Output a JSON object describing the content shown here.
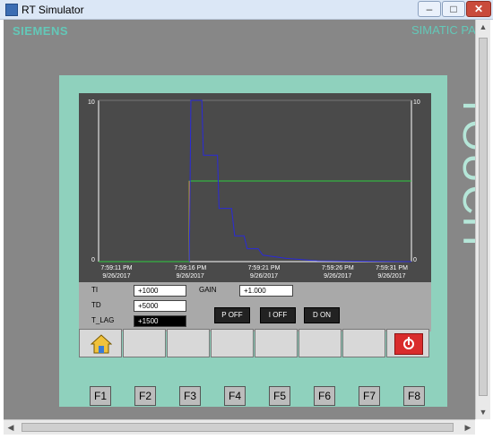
{
  "window": {
    "title": "RT Simulator",
    "min_glyph": "–",
    "max_glyph": "□",
    "close_glyph": "✕"
  },
  "panel": {
    "brand": "SIEMENS",
    "model": "SIMATIC PA",
    "bezel_text": "TOUCH"
  },
  "chart_data": {
    "type": "line",
    "y_left_max_label": "10",
    "y_left_min_label": "0",
    "y_right_max_label": "10",
    "y_right_min_label": "0",
    "ylim": [
      0,
      10
    ],
    "x_ticks": [
      {
        "time": "7:59:11 PM",
        "date": "9/26/2017"
      },
      {
        "time": "7:59:16 PM",
        "date": "9/26/2017"
      },
      {
        "time": "7:59:21 PM",
        "date": "9/26/2017"
      },
      {
        "time": "7:59:26 PM",
        "date": "9/26/2017"
      },
      {
        "time": "7:59:31 PM",
        "date": "9/26/2017"
      }
    ],
    "series": [
      {
        "color": "#2ecc40",
        "points": [
          [
            0,
            0
          ],
          [
            5.8,
            0
          ],
          [
            5.8,
            5
          ],
          [
            20,
            5
          ]
        ]
      },
      {
        "color": "#f5a623",
        "points": [
          [
            5.8,
            0
          ],
          [
            5.8,
            5
          ]
        ]
      },
      {
        "color": "#2a2ad8",
        "points": [
          [
            5.8,
            0
          ],
          [
            5.9,
            10
          ],
          [
            6.6,
            10
          ],
          [
            6.7,
            6.6
          ],
          [
            7.6,
            6.6
          ],
          [
            7.7,
            3.3
          ],
          [
            8.5,
            3.3
          ],
          [
            8.7,
            1.6
          ],
          [
            9.3,
            1.6
          ],
          [
            9.5,
            0.8
          ],
          [
            10.2,
            0.8
          ],
          [
            10.5,
            0.4
          ],
          [
            12,
            0.2
          ],
          [
            14,
            0.05
          ],
          [
            20,
            0
          ]
        ]
      }
    ]
  },
  "params": {
    "ti_label": "TI",
    "ti_value": "+1000",
    "td_label": "TD",
    "td_value": "+5000",
    "tlag_label": "T_LAG",
    "tlag_value": "+1500",
    "gain_label": "GAIN",
    "gain_value": "+1.000"
  },
  "buttons": {
    "p_off": "P OFF",
    "i_off": "I OFF",
    "d_on": "D ON"
  },
  "fkeys": [
    "F1",
    "F2",
    "F3",
    "F4",
    "F5",
    "F6",
    "F7",
    "F8"
  ],
  "scroll": {
    "up": "▲",
    "down": "▼",
    "left": "◀",
    "right": "▶"
  },
  "colors": {
    "bezel": "#8fd1bd",
    "chart_bg": "#4a4a4a",
    "stop_red": "#d92c2c"
  }
}
